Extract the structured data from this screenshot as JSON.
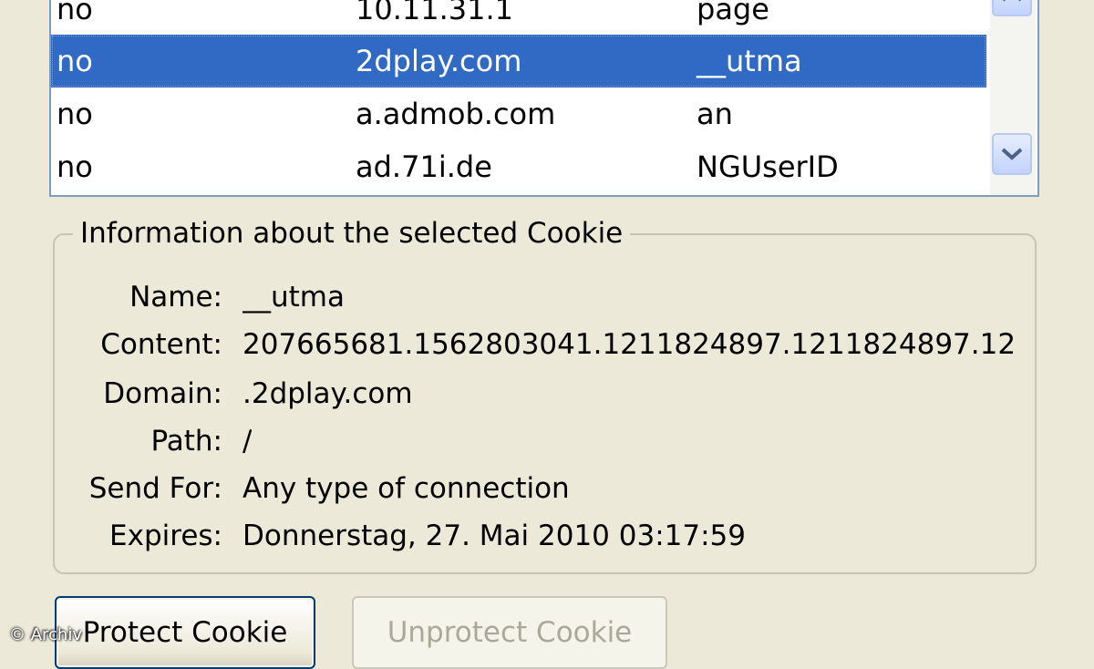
{
  "cookie_list": {
    "rows": [
      {
        "blocked": "no",
        "site": "10.11.31.1",
        "name": "page",
        "selected": false
      },
      {
        "blocked": "no",
        "site": "2dplay.com",
        "name": "__utma",
        "selected": true
      },
      {
        "blocked": "no",
        "site": "a.admob.com",
        "name": "an",
        "selected": false
      },
      {
        "blocked": "no",
        "site": "ad.71i.de",
        "name": "NGUserID",
        "selected": false
      }
    ]
  },
  "details": {
    "group_title": "Information about the selected Cookie",
    "fields": [
      {
        "label": "Name:",
        "value": "__utma"
      },
      {
        "label": "Content:",
        "value": "207665681.1562803041.1211824897.1211824897.12"
      },
      {
        "label": "Domain:",
        "value": ".2dplay.com"
      },
      {
        "label": "Path:",
        "value": "/"
      },
      {
        "label": "Send For:",
        "value": "Any type of connection"
      },
      {
        "label": "Expires:",
        "value": "Donnerstag, 27. Mai 2010 03:17:59"
      }
    ]
  },
  "buttons": {
    "protect": "Protect Cookie",
    "unprotect": "Unprotect Cookie"
  },
  "watermark": "© Archiv",
  "icons": {
    "scroll_up": "chevron-up-icon",
    "scroll_down": "chevron-down-icon"
  },
  "colors": {
    "selection": "#316ac5",
    "dialog_bg": "#ece9d8",
    "list_border": "#7f9db9"
  }
}
